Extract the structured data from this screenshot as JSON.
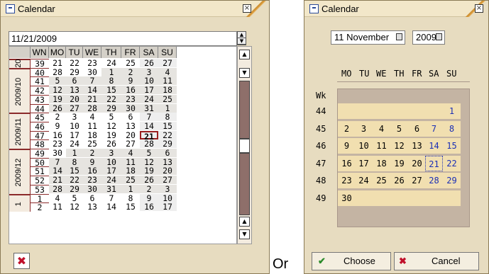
{
  "left_window": {
    "title": "Calendar",
    "date_value": "11/21/2009",
    "headers": [
      "WN",
      "MO",
      "TU",
      "WE",
      "TH",
      "FR",
      "SA",
      "SU"
    ],
    "months": [
      "20",
      "2009/10",
      "2009/11",
      "2009/12",
      "1"
    ],
    "rows": [
      {
        "wk": "39",
        "days": [
          "21",
          "22",
          "23",
          "24",
          "25",
          "26",
          "27"
        ]
      },
      {
        "wk": "40",
        "days": [
          "28",
          "29",
          "30",
          "1",
          "2",
          "3",
          "4"
        ]
      },
      {
        "wk": "41",
        "days": [
          "5",
          "6",
          "7",
          "8",
          "9",
          "10",
          "11"
        ]
      },
      {
        "wk": "42",
        "days": [
          "12",
          "13",
          "14",
          "15",
          "16",
          "17",
          "18"
        ]
      },
      {
        "wk": "43",
        "days": [
          "19",
          "20",
          "21",
          "22",
          "23",
          "24",
          "25"
        ]
      },
      {
        "wk": "44",
        "days": [
          "26",
          "27",
          "28",
          "29",
          "30",
          "31",
          "1"
        ]
      },
      {
        "wk": "45",
        "days": [
          "2",
          "3",
          "4",
          "5",
          "6",
          "7",
          "8"
        ]
      },
      {
        "wk": "46",
        "days": [
          "9",
          "10",
          "11",
          "12",
          "13",
          "14",
          "15"
        ]
      },
      {
        "wk": "47",
        "days": [
          "16",
          "17",
          "18",
          "19",
          "20",
          "21",
          "22"
        ]
      },
      {
        "wk": "48",
        "days": [
          "23",
          "24",
          "25",
          "26",
          "27",
          "28",
          "29"
        ]
      },
      {
        "wk": "49",
        "days": [
          "30",
          "1",
          "2",
          "3",
          "4",
          "5",
          "6"
        ]
      },
      {
        "wk": "50",
        "days": [
          "7",
          "8",
          "9",
          "10",
          "11",
          "12",
          "13"
        ]
      },
      {
        "wk": "51",
        "days": [
          "14",
          "15",
          "16",
          "17",
          "18",
          "19",
          "20"
        ]
      },
      {
        "wk": "52",
        "days": [
          "21",
          "22",
          "23",
          "24",
          "25",
          "26",
          "27"
        ]
      },
      {
        "wk": "53",
        "days": [
          "28",
          "29",
          "30",
          "31",
          "1",
          "2",
          "3"
        ]
      },
      {
        "wk": "1",
        "days": [
          "4",
          "5",
          "6",
          "7",
          "8",
          "9",
          "10"
        ]
      },
      {
        "wk": "2",
        "days": [
          "11",
          "12",
          "13",
          "14",
          "15",
          "16",
          "17"
        ]
      }
    ],
    "selected_day": "21",
    "close_icon": "close-icon",
    "cancel_icon": "x-icon"
  },
  "or_label": "Or",
  "right_window": {
    "title": "Calendar",
    "month_value": "11 November",
    "year_value": "2009",
    "dow": [
      "MO",
      "TU",
      "WE",
      "TH",
      "FR",
      "SA",
      "SU"
    ],
    "wk_label": "Wk",
    "weeks": [
      {
        "wk": "44",
        "days": [
          "",
          "",
          "",
          "",
          "",
          "",
          "1"
        ]
      },
      {
        "wk": "45",
        "days": [
          "2",
          "3",
          "4",
          "5",
          "6",
          "7",
          "8"
        ]
      },
      {
        "wk": "46",
        "days": [
          "9",
          "10",
          "11",
          "12",
          "13",
          "14",
          "15"
        ]
      },
      {
        "wk": "47",
        "days": [
          "16",
          "17",
          "18",
          "19",
          "20",
          "21",
          "22"
        ]
      },
      {
        "wk": "48",
        "days": [
          "23",
          "24",
          "25",
          "26",
          "27",
          "28",
          "29"
        ]
      },
      {
        "wk": "49",
        "days": [
          "30",
          "",
          "",
          "",
          "",
          "",
          ""
        ]
      }
    ],
    "selected_day": "21",
    "choose_label": "Choose",
    "cancel_label": "Cancel",
    "colors": {
      "weekend": "#1b2fb5",
      "cell": "#f1dfb0",
      "panel": "#c4b4a3"
    }
  }
}
